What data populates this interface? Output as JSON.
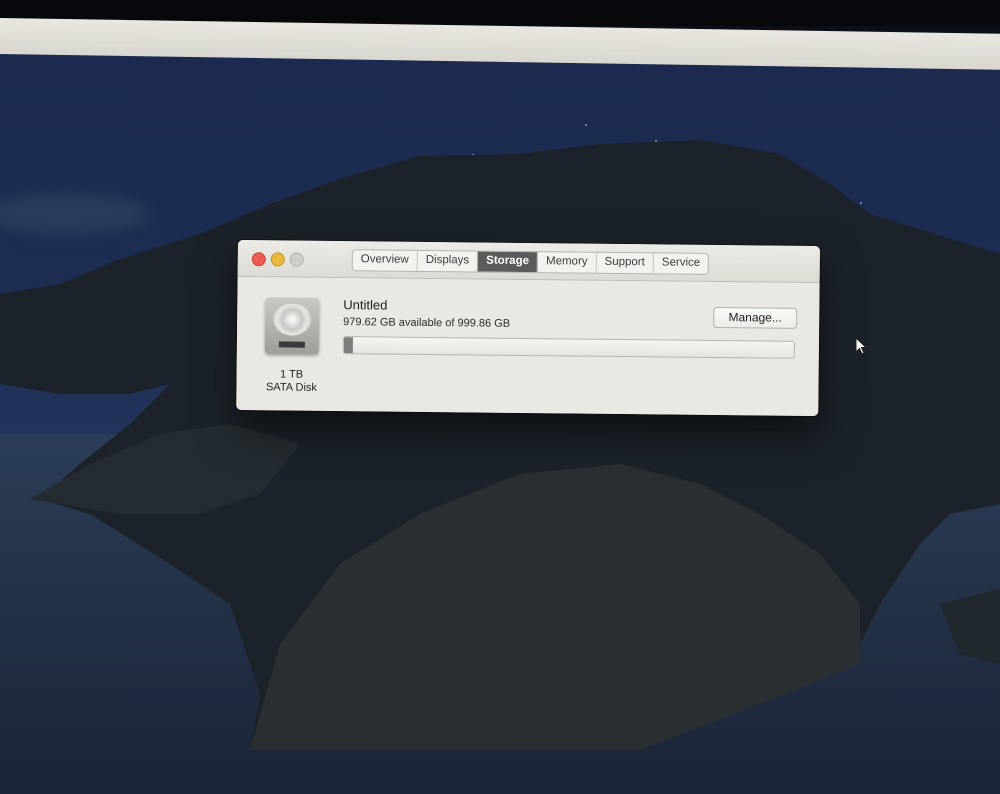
{
  "window": {
    "tabs": [
      {
        "label": "Overview",
        "active": false
      },
      {
        "label": "Displays",
        "active": false
      },
      {
        "label": "Storage",
        "active": true
      },
      {
        "label": "Memory",
        "active": false
      },
      {
        "label": "Support",
        "active": false
      },
      {
        "label": "Service",
        "active": false
      }
    ]
  },
  "disk": {
    "icon": "hard-drive-icon",
    "size": "1 TB",
    "type": "SATA Disk"
  },
  "volume": {
    "name": "Untitled",
    "availability": "979.62 GB available of 999.86 GB",
    "used_fraction": 0.02
  },
  "manage_button": {
    "label": "Manage..."
  },
  "colors": {
    "close": "#ec5b4f",
    "minimize": "#e8b83a",
    "active_tab": "#5b5b5b"
  }
}
